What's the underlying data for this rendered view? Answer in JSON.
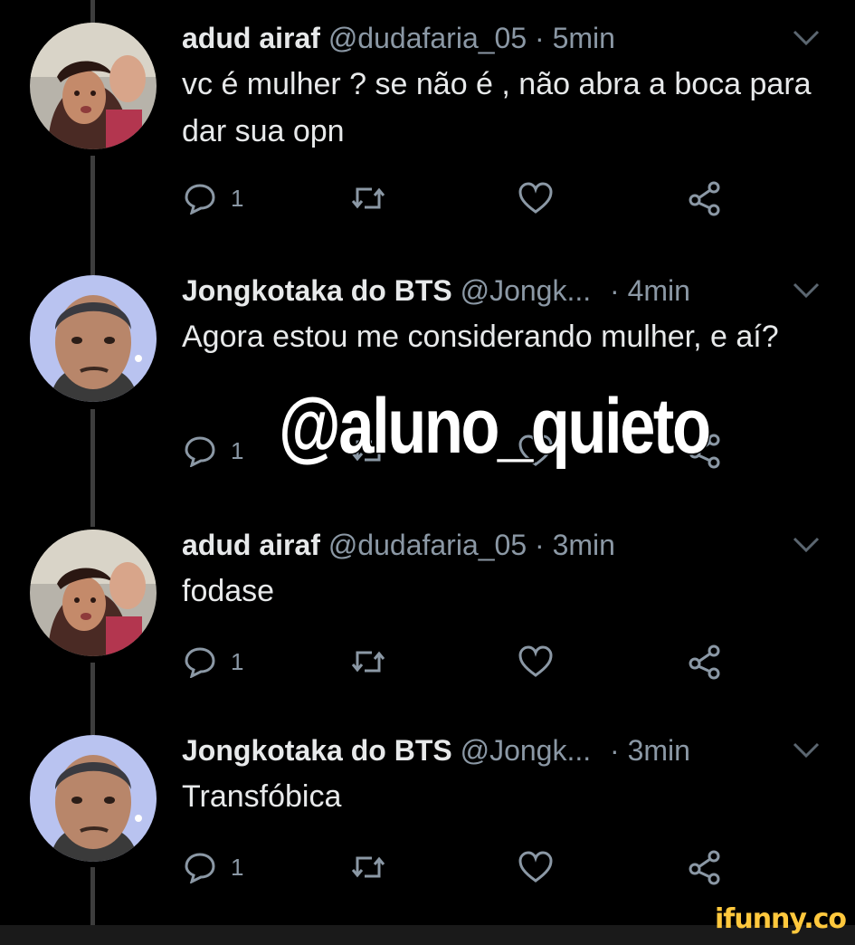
{
  "tweets": [
    {
      "name": "adud airaf",
      "handle": "@dudafaria_05",
      "dot": "·",
      "time": "5min",
      "text": "vc é mulher ? se não é , não abra a boca para dar sua opn",
      "reply_count": "1",
      "avatar": "woman-avatar"
    },
    {
      "name": "Jongkotaka do BTS",
      "handle": "@Jongk...",
      "dot": "·",
      "time": "4min",
      "text": "Agora estou me considerando mulher, e aí?",
      "reply_count": "1",
      "avatar": "man-avatar"
    },
    {
      "name": "adud airaf",
      "handle": "@dudafaria_05",
      "dot": "·",
      "time": "3min",
      "text": "fodase",
      "reply_count": "1",
      "avatar": "woman-avatar"
    },
    {
      "name": "Jongkotaka do BTS",
      "handle": "@Jongk...",
      "dot": "·",
      "time": "3min",
      "text": "Transfóbica",
      "reply_count": "1",
      "avatar": "man-avatar"
    }
  ],
  "watermark": "@aluno_quieto",
  "footer_brand": "ifunny.co",
  "icons": {
    "reply": "reply-icon",
    "retweet": "retweet-icon",
    "like": "heart-icon",
    "share": "share-icon",
    "caret": "chevron-down-icon"
  },
  "colors": {
    "background": "#000000",
    "muted": "#8b98a5",
    "text": "#e7e9ea",
    "brand": "#ffc83d"
  }
}
